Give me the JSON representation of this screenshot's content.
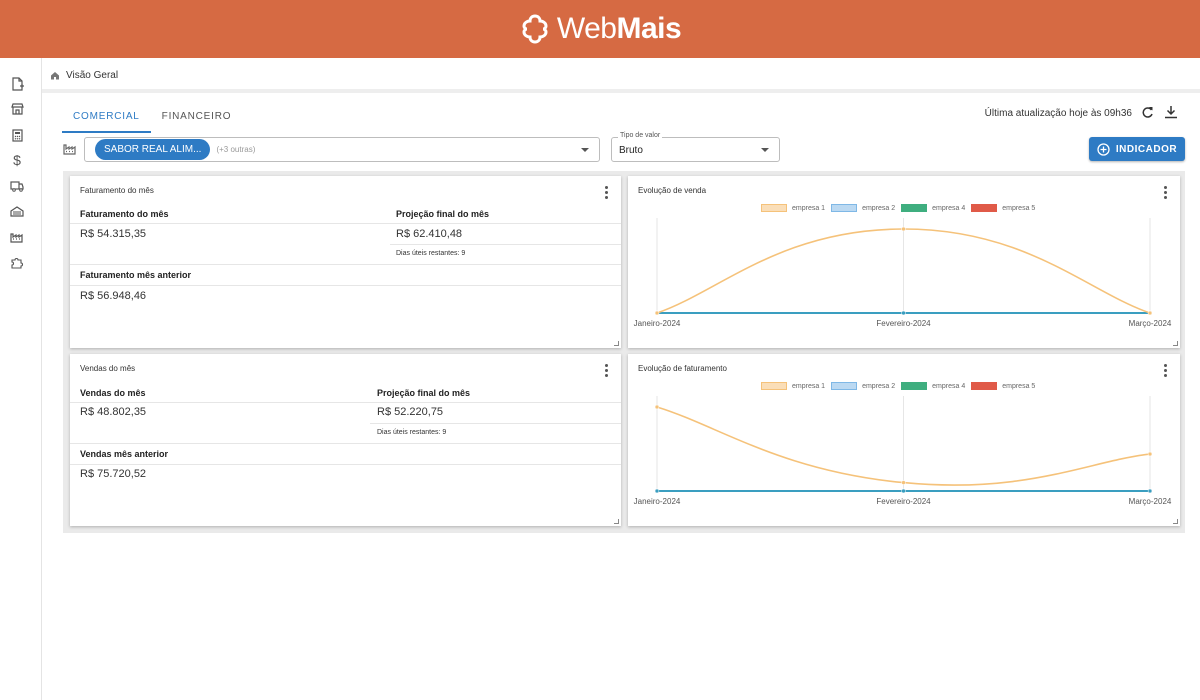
{
  "header": {
    "logo_prefix": "Web",
    "logo_suffix": "Mais",
    "brand_color": "#d66a43"
  },
  "sidebar": {
    "icons": [
      "new-document-icon",
      "store-icon",
      "calculator-icon",
      "dollar-icon",
      "truck-icon",
      "garage-icon",
      "factory-icon",
      "puzzle-icon"
    ]
  },
  "breadcrumb": {
    "label": "Visão Geral"
  },
  "tabs": [
    {
      "label": "COMERCIAL",
      "active": true
    },
    {
      "label": "FINANCEIRO",
      "active": false
    }
  ],
  "toolbar": {
    "update_text": "Última atualização hoje às 09h36",
    "indicator_button": "INDICADOR",
    "accent": "#2e7bc4"
  },
  "filters": {
    "company_chip": "SABOR REAL ALIM...",
    "company_more": "(+3 outras)",
    "value_type_label": "Tipo de valor",
    "value_type_value": "Bruto"
  },
  "cards": {
    "faturamento": {
      "title": "Faturamento do mês",
      "left_label": "Faturamento do mês",
      "left_value": "R$ 54.315,35",
      "right_label": "Projeção final do mês",
      "right_value": "R$ 62.410,48",
      "days_left": "Dias úteis restantes: 9",
      "prev_label": "Faturamento mês anterior",
      "prev_value": "R$ 56.948,46"
    },
    "vendas": {
      "title": "Vendas do mês",
      "left_label": "Vendas do mês",
      "left_value": "R$ 48.802,35",
      "right_label": "Projeção final do mês",
      "right_value": "R$ 52.220,75",
      "days_left": "Dias úteis restantes: 9",
      "prev_label": "Vendas mês anterior",
      "prev_value": "R$ 75.720,52"
    }
  },
  "chart_data": [
    {
      "type": "line",
      "title": "Evolução de venda",
      "categories": [
        "Janeiro-2024",
        "Fevereiro-2024",
        "Março-2024"
      ],
      "series": [
        {
          "name": "empresa 1",
          "values": [
            0,
            100,
            0
          ],
          "color": "#f5c27a"
        },
        {
          "name": "empresa 2",
          "values": [
            0,
            0,
            0
          ],
          "color": "#7fb8e6"
        },
        {
          "name": "empresa 4",
          "values": [
            0,
            0,
            0
          ],
          "color": "#3fae7f"
        },
        {
          "name": "empresa 5",
          "values": [
            0,
            0,
            0
          ],
          "color": "#e05a48"
        }
      ],
      "ylim": [
        0,
        100
      ],
      "legend": "top-center",
      "grid": true
    },
    {
      "type": "line",
      "title": "Evolução de faturamento",
      "categories": [
        "Janeiro-2024",
        "Fevereiro-2024",
        "Março-2024"
      ],
      "series": [
        {
          "name": "empresa 1",
          "values": [
            100,
            10,
            44
          ],
          "color": "#f5c27a"
        },
        {
          "name": "empresa 2",
          "values": [
            0,
            0,
            0
          ],
          "color": "#7fb8e6"
        },
        {
          "name": "empresa 4",
          "values": [
            0,
            0,
            0
          ],
          "color": "#3fae7f"
        },
        {
          "name": "empresa 5",
          "values": [
            0,
            0,
            0
          ],
          "color": "#e05a48"
        }
      ],
      "ylim": [
        0,
        100
      ],
      "legend": "top-center",
      "grid": true
    }
  ]
}
